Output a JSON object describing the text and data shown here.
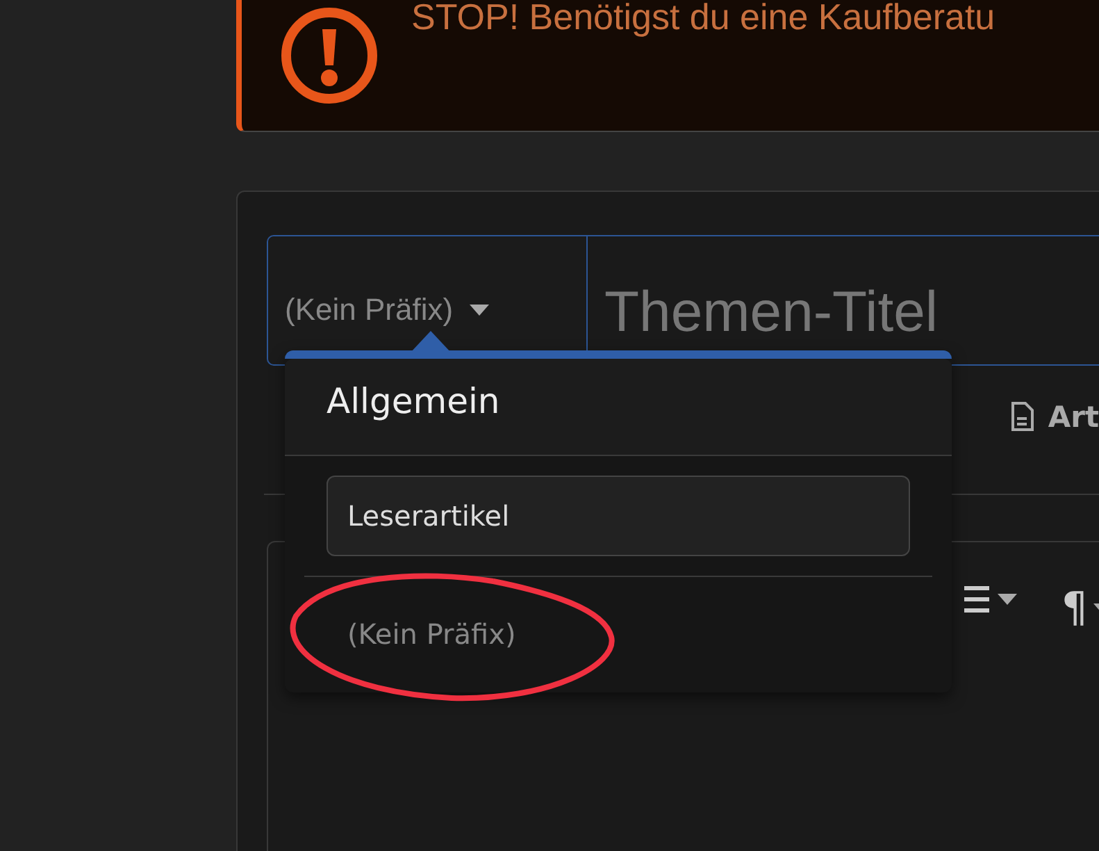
{
  "alert": {
    "message": "STOP! Benötigst du eine Kaufberatu"
  },
  "thread_form": {
    "prefix_select": {
      "value": "(Kein Präfix)"
    },
    "title_field": {
      "placeholder": "Themen-Titel"
    },
    "tabs": [
      {
        "label": "Art"
      }
    ],
    "editor_toolbar": [
      {
        "kind": "list"
      },
      {
        "kind": "paragraph",
        "label": "¶"
      }
    ]
  },
  "prefix_menu": {
    "open": true,
    "groups": [
      {
        "title": "Allgemein",
        "options": [
          {
            "label": "Leserartikel",
            "highlighted": true
          }
        ]
      }
    ],
    "other_options": [
      {
        "label": "(Kein Präfix)",
        "highlighted": false
      }
    ]
  },
  "annotation": {
    "kind": "ellipse"
  }
}
